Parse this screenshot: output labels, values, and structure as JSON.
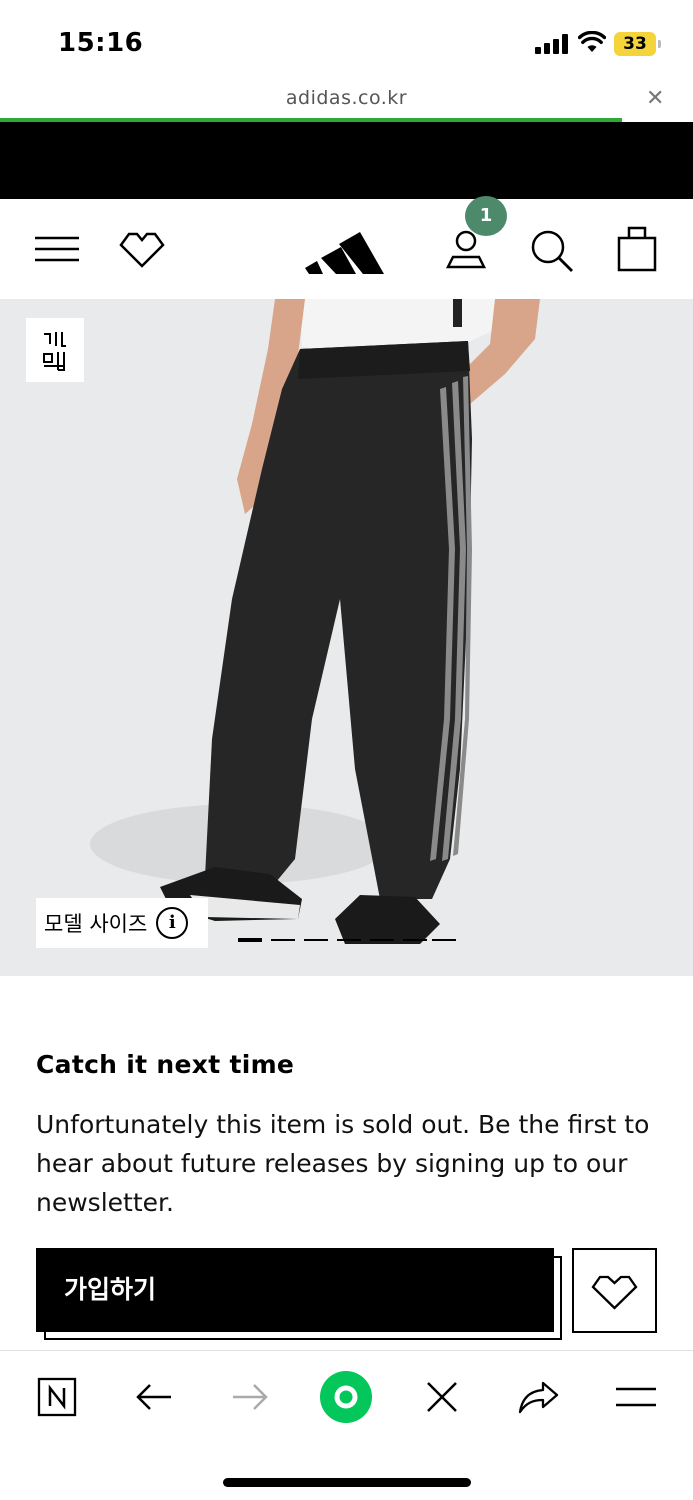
{
  "status_bar": {
    "time": "15:16",
    "battery": "33"
  },
  "browser": {
    "url": "adidas.co.kr",
    "close_icon": "close-icon"
  },
  "header": {
    "cart_badge_count": "1",
    "icons": [
      "menu-icon",
      "heart-icon",
      "adidas-logo",
      "account-icon",
      "search-icon",
      "bag-icon"
    ]
  },
  "product": {
    "brand_tag": "지속\n가능",
    "model_size_label": "모델 사이즈",
    "carousel_count": 7,
    "carousel_active": 0
  },
  "content": {
    "headline": "Catch it next time",
    "description": "Unfortunately this item is sold out. Be the first to hear about future releases by signing up to our newsletter.",
    "join_label": "가입하기"
  },
  "toolbar": {
    "items": [
      "naver-icon",
      "back-icon",
      "forward-icon",
      "green-home-icon",
      "close-icon",
      "share-icon",
      "menu-icon"
    ]
  },
  "colors": {
    "progress": "#2ea836",
    "badge": "#4c8a6b",
    "battery": "#f5d33a",
    "naver_green": "#03c75a"
  }
}
